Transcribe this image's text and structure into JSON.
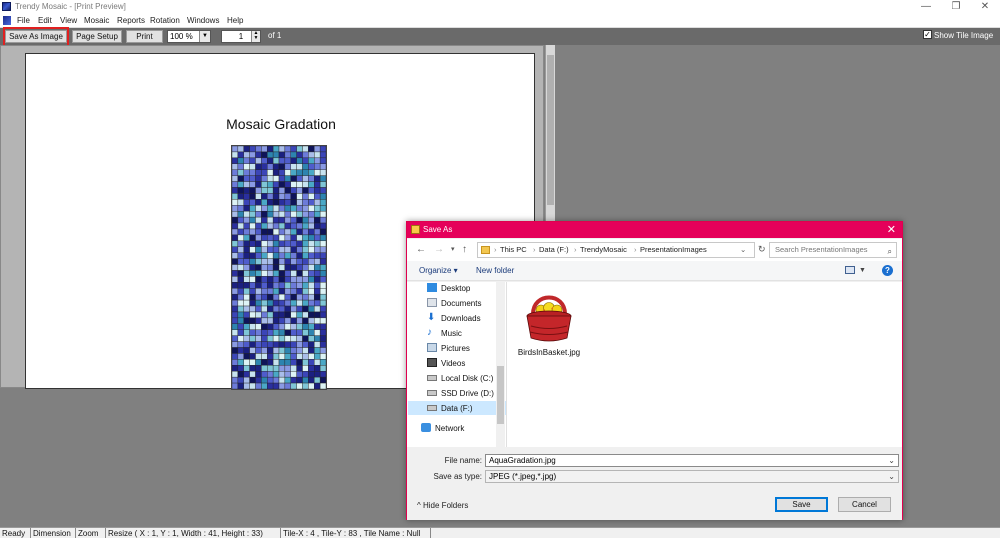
{
  "window": {
    "title": "Trendy Mosaic - [Print Preview]",
    "minimize_glyph": "—",
    "restore_glyph": "❐",
    "close_glyph": "✕"
  },
  "menu": {
    "items": [
      "File",
      "Edit",
      "View",
      "Mosaic",
      "Reports",
      "Rotation",
      "Windows",
      "Help"
    ]
  },
  "toolbar": {
    "save_as_image": "Save As Image",
    "page_setup": "Page Setup",
    "print": "Print",
    "zoom": "100 %",
    "page_number": "1",
    "page_of": "of 1",
    "show_tile_image": "Show Tile Image",
    "show_tile_checked": true
  },
  "preview": {
    "page_title": "Mosaic Gradation",
    "mosaic_colors": [
      "#0f1459",
      "#1b2080",
      "#2a2f9e",
      "#3b45b8",
      "#4f5ccc",
      "#6c7bd9",
      "#8a9ae3",
      "#a9bde9",
      "#c7e3ef",
      "#ddf3f5",
      "#7fc6d6",
      "#4aa8c6",
      "#2d84b0"
    ]
  },
  "dialog": {
    "title": "Save As",
    "breadcrumb": [
      "This PC",
      "Data (F:)",
      "TrendyMosaic",
      "PresentationImages"
    ],
    "search_placeholder": "Search PresentationImages",
    "organize": "Organize ▾",
    "new_folder": "New folder",
    "help": "?",
    "nav_items": [
      {
        "label": "Desktop",
        "icon": "desktop-icon"
      },
      {
        "label": "Documents",
        "icon": "documents-icon"
      },
      {
        "label": "Downloads",
        "icon": "downloads-icon"
      },
      {
        "label": "Music",
        "icon": "music-icon"
      },
      {
        "label": "Pictures",
        "icon": "pictures-icon"
      },
      {
        "label": "Videos",
        "icon": "videos-icon"
      },
      {
        "label": "Local Disk (C:)",
        "icon": "drive-icon"
      },
      {
        "label": "SSD Drive (D:)",
        "icon": "drive-icon"
      },
      {
        "label": "Data (F:)",
        "icon": "drive-icon"
      },
      {
        "label": "Network",
        "icon": "network-icon"
      }
    ],
    "selected_nav": "Data (F:)",
    "files": [
      {
        "name": "BirdsInBasket.jpg",
        "icon": "birds-in-basket-thumbnail"
      }
    ],
    "file_name_label": "File name:",
    "file_name_value": "AquaGradation.jpg",
    "save_as_type_label": "Save as type:",
    "save_as_type_value": "JPEG (*.jpeg,*.jpg)",
    "hide_folders": "Hide Folders",
    "save_button": "Save",
    "cancel_button": "Cancel"
  },
  "status": {
    "cells": [
      "Ready",
      "Dimension",
      "Zoom",
      "Resize ( X : 1, Y : 1, Width : 41, Height : 33)",
      "Tile-X : 4 , Tile-Y : 83 , Tile Name : Null"
    ]
  },
  "colors": {
    "dialog_accent": "#e5005a",
    "highlight": "#e02020",
    "workspace": "#808080"
  }
}
